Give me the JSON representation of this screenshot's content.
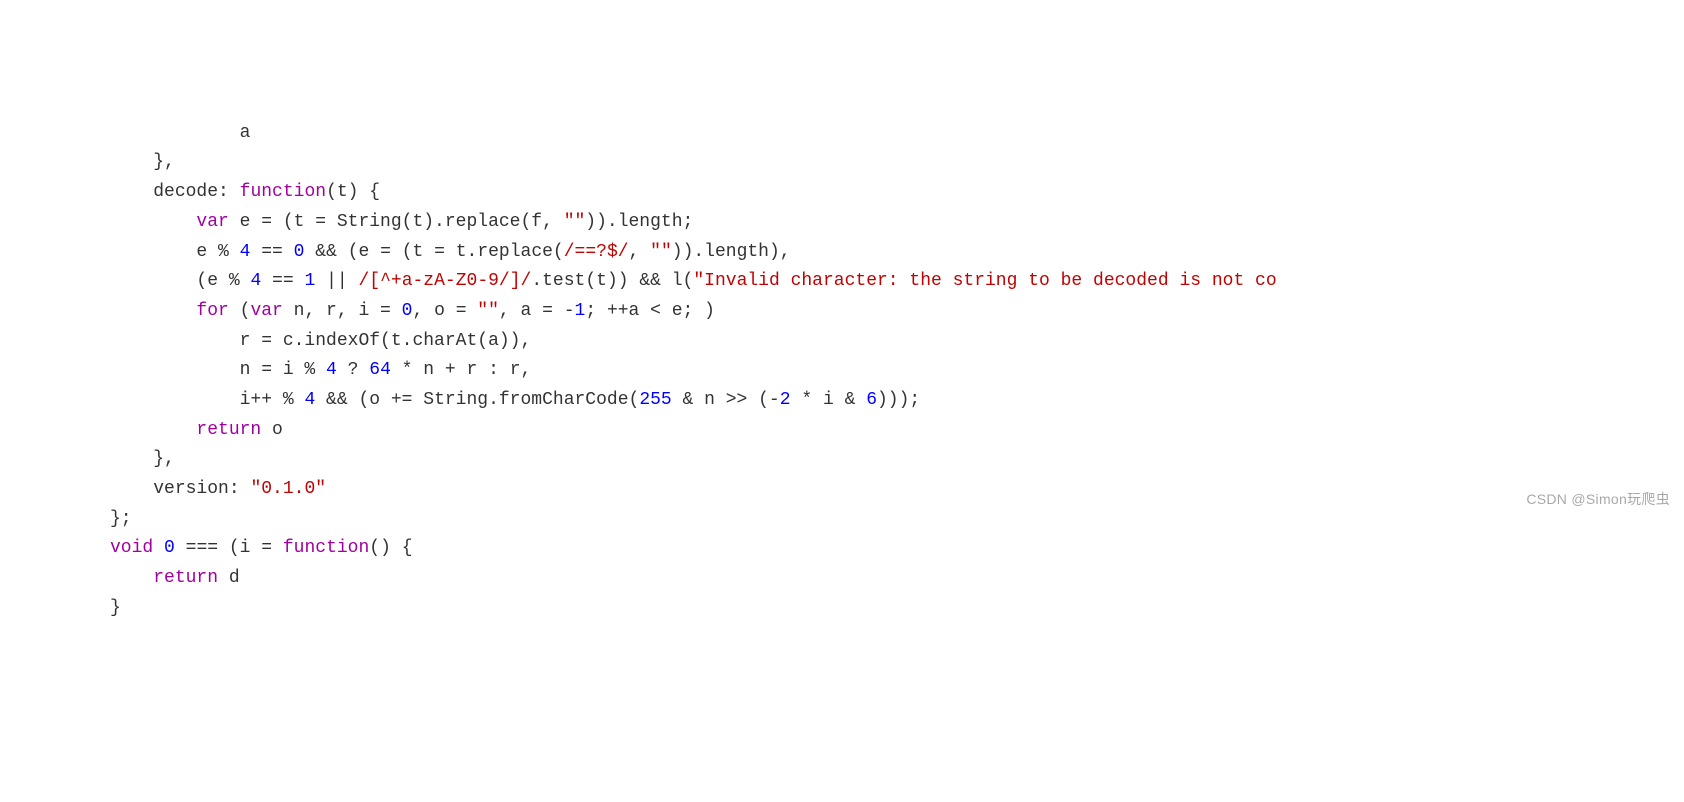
{
  "watermark": "CSDN @Simon玩爬虫",
  "code": {
    "lines": [
      {
        "indent": 12,
        "tokens": [
          {
            "cls": "tok-id",
            "text": "a"
          }
        ]
      },
      {
        "indent": 4,
        "tokens": [
          {
            "cls": "tok-punct",
            "text": "},"
          }
        ]
      },
      {
        "indent": 4,
        "tokens": [
          {
            "cls": "tok-id",
            "text": "decode"
          },
          {
            "cls": "tok-punct",
            "text": ": "
          },
          {
            "cls": "tok-keyword-purple",
            "text": "function"
          },
          {
            "cls": "tok-punct",
            "text": "(t) {"
          }
        ]
      },
      {
        "indent": 8,
        "tokens": [
          {
            "cls": "tok-keyword-purple",
            "text": "var"
          },
          {
            "cls": "tok-punct",
            "text": " e = (t = String(t).replace(f, "
          },
          {
            "cls": "tok-string",
            "text": "\"\""
          },
          {
            "cls": "tok-punct",
            "text": ")).length;"
          }
        ]
      },
      {
        "indent": 8,
        "tokens": [
          {
            "cls": "tok-punct",
            "text": "e % "
          },
          {
            "cls": "tok-number",
            "text": "4"
          },
          {
            "cls": "tok-punct",
            "text": " == "
          },
          {
            "cls": "tok-number",
            "text": "0"
          },
          {
            "cls": "tok-punct",
            "text": " && (e = (t = t.replace("
          },
          {
            "cls": "tok-regex",
            "text": "/==?$/"
          },
          {
            "cls": "tok-punct",
            "text": ", "
          },
          {
            "cls": "tok-string",
            "text": "\"\""
          },
          {
            "cls": "tok-punct",
            "text": ")).length),"
          }
        ]
      },
      {
        "indent": 8,
        "tokens": [
          {
            "cls": "tok-punct",
            "text": "(e % "
          },
          {
            "cls": "tok-number",
            "text": "4"
          },
          {
            "cls": "tok-punct",
            "text": " == "
          },
          {
            "cls": "tok-number",
            "text": "1"
          },
          {
            "cls": "tok-punct",
            "text": " || "
          },
          {
            "cls": "tok-regex",
            "text": "/[^+a-zA-Z0-9/]/"
          },
          {
            "cls": "tok-punct",
            "text": ".test(t)) && l("
          },
          {
            "cls": "tok-string",
            "text": "\"Invalid character: the string to be decoded is not co"
          }
        ]
      },
      {
        "indent": 8,
        "tokens": [
          {
            "cls": "tok-keyword-purple",
            "text": "for"
          },
          {
            "cls": "tok-punct",
            "text": " ("
          },
          {
            "cls": "tok-keyword-purple",
            "text": "var"
          },
          {
            "cls": "tok-punct",
            "text": " n, r, i = "
          },
          {
            "cls": "tok-number",
            "text": "0"
          },
          {
            "cls": "tok-punct",
            "text": ", o = "
          },
          {
            "cls": "tok-string",
            "text": "\"\""
          },
          {
            "cls": "tok-punct",
            "text": ", a = -"
          },
          {
            "cls": "tok-number",
            "text": "1"
          },
          {
            "cls": "tok-punct",
            "text": "; ++a < e; )"
          }
        ]
      },
      {
        "indent": 12,
        "tokens": [
          {
            "cls": "tok-punct",
            "text": "r = c.indexOf(t.charAt(a)),"
          }
        ]
      },
      {
        "indent": 12,
        "tokens": [
          {
            "cls": "tok-punct",
            "text": "n = i % "
          },
          {
            "cls": "tok-number",
            "text": "4"
          },
          {
            "cls": "tok-punct",
            "text": " ? "
          },
          {
            "cls": "tok-number",
            "text": "64"
          },
          {
            "cls": "tok-punct",
            "text": " * n + r : r,"
          }
        ]
      },
      {
        "indent": 12,
        "tokens": [
          {
            "cls": "tok-punct",
            "text": "i++ % "
          },
          {
            "cls": "tok-number",
            "text": "4"
          },
          {
            "cls": "tok-punct",
            "text": " && (o += String.fromCharCode("
          },
          {
            "cls": "tok-number",
            "text": "255"
          },
          {
            "cls": "tok-punct",
            "text": " & n >> (-"
          },
          {
            "cls": "tok-number",
            "text": "2"
          },
          {
            "cls": "tok-punct",
            "text": " * i & "
          },
          {
            "cls": "tok-number",
            "text": "6"
          },
          {
            "cls": "tok-punct",
            "text": ")));"
          }
        ]
      },
      {
        "indent": 8,
        "tokens": [
          {
            "cls": "tok-keyword-purple",
            "text": "return"
          },
          {
            "cls": "tok-punct",
            "text": " o"
          }
        ]
      },
      {
        "indent": 4,
        "tokens": [
          {
            "cls": "tok-punct",
            "text": "},"
          }
        ]
      },
      {
        "indent": 4,
        "tokens": [
          {
            "cls": "tok-id",
            "text": "version"
          },
          {
            "cls": "tok-punct",
            "text": ": "
          },
          {
            "cls": "tok-string",
            "text": "\"0.1.0\""
          }
        ]
      },
      {
        "indent": 0,
        "tokens": [
          {
            "cls": "tok-punct",
            "text": "};"
          }
        ]
      },
      {
        "indent": 0,
        "tokens": [
          {
            "cls": "tok-keyword-purple",
            "text": "void"
          },
          {
            "cls": "tok-punct",
            "text": " "
          },
          {
            "cls": "tok-number",
            "text": "0"
          },
          {
            "cls": "tok-punct",
            "text": " === (i = "
          },
          {
            "cls": "tok-keyword-purple",
            "text": "function"
          },
          {
            "cls": "tok-punct",
            "text": "() {"
          }
        ]
      },
      {
        "indent": 4,
        "tokens": [
          {
            "cls": "tok-keyword-purple",
            "text": "return"
          },
          {
            "cls": "tok-punct",
            "text": " d"
          }
        ]
      },
      {
        "indent": 0,
        "tokens": [
          {
            "cls": "tok-punct",
            "text": "}"
          }
        ]
      }
    ]
  }
}
